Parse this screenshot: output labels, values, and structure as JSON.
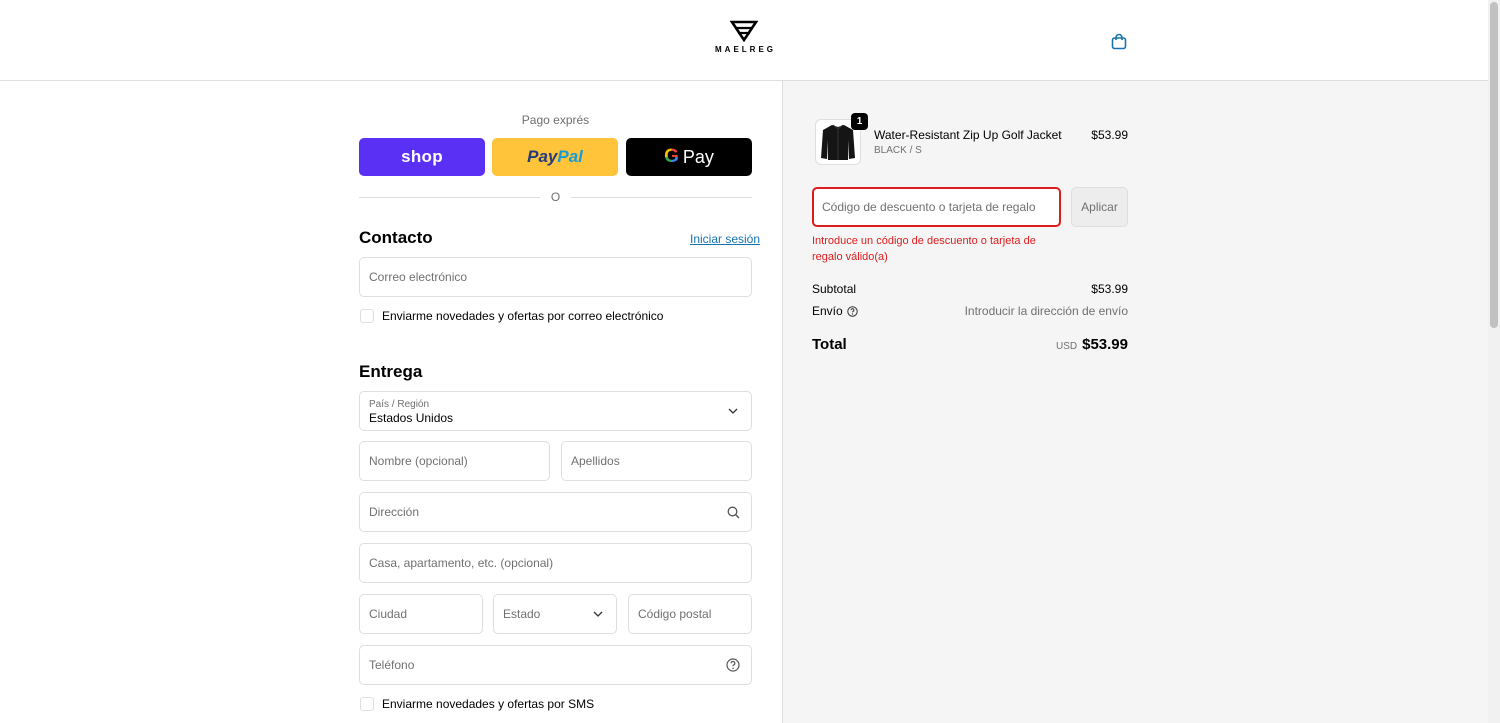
{
  "header": {
    "brand": "MAELREG"
  },
  "express": {
    "label": "Pago exprés",
    "shop_label": "shop",
    "paypal_part1": "Pay",
    "paypal_part2": "Pal",
    "gpay_g": "G",
    "gpay_label": "Pay",
    "divider": "O"
  },
  "contact": {
    "title": "Contacto",
    "login_link": "Iniciar sesión",
    "email_placeholder": "Correo electrónico",
    "newsletter_label": "Enviarme novedades y ofertas por correo electrónico"
  },
  "delivery": {
    "title": "Entrega",
    "country_label": "País / Región",
    "country_value": "Estados Unidos",
    "first_name_placeholder": "Nombre (opcional)",
    "last_name_placeholder": "Apellidos",
    "address_placeholder": "Dirección",
    "apartment_placeholder": "Casa, apartamento, etc. (opcional)",
    "city_placeholder": "Ciudad",
    "state_label": "Estado",
    "postal_placeholder": "Código postal",
    "phone_placeholder": "Teléfono",
    "sms_label": "Enviarme novedades y ofertas por SMS"
  },
  "summary": {
    "product": {
      "quantity": "1",
      "name": "Water-Resistant Zip Up Golf Jacket",
      "variant": "BLACK / S",
      "price": "$53.99"
    },
    "discount_placeholder": "Código de descuento o tarjeta de regalo",
    "apply_label": "Aplicar",
    "error": "Introduce un código de descuento o tarjeta de regalo válido(a)",
    "subtotal_label": "Subtotal",
    "subtotal_value": "$53.99",
    "shipping_label": "Envío",
    "shipping_value": "Introducir la dirección de envío",
    "total_label": "Total",
    "total_currency": "USD",
    "total_value": "$53.99"
  },
  "colors": {
    "accent_link": "#1773b0",
    "error": "#dd1d1d",
    "shop_pay": "#5a31f4",
    "paypal": "#ffc439",
    "gpay": "#000000"
  },
  "icons": {
    "logo": "maelreg-logo-icon",
    "cart": "shopping-bag-icon",
    "chevron": "chevron-down-icon",
    "search": "search-icon",
    "help": "help-circle-icon",
    "product": "jacket-thumbnail"
  }
}
